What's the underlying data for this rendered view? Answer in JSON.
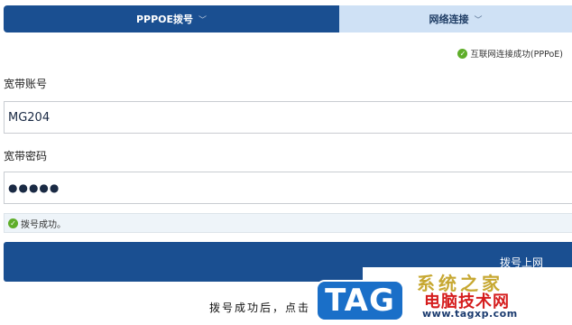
{
  "tabs": [
    {
      "label": "PPPOE拨号",
      "active": true
    },
    {
      "label": "网络连接",
      "active": false
    }
  ],
  "connection_status": {
    "icon": "check-circle-icon",
    "text": "互联网连接成功(PPPoE)"
  },
  "form": {
    "account_label": "宽带账号",
    "account_value": "MG204",
    "password_label": "宽带密码",
    "password_mask": "●●●●●"
  },
  "dial_status": {
    "icon": "check-circle-icon",
    "text": "拨号成功。"
  },
  "dial_button_label": "拨号上网",
  "instruction_text": "拨号成功后，点击",
  "watermark": {
    "badge": "TAG",
    "title": "系统之家",
    "subtitle": "电脑技术网",
    "url": "www.tagxp.com"
  },
  "colors": {
    "primary": "#1a4f91",
    "tab_inactive": "#cfe1f5",
    "success": "#5fae2a"
  }
}
